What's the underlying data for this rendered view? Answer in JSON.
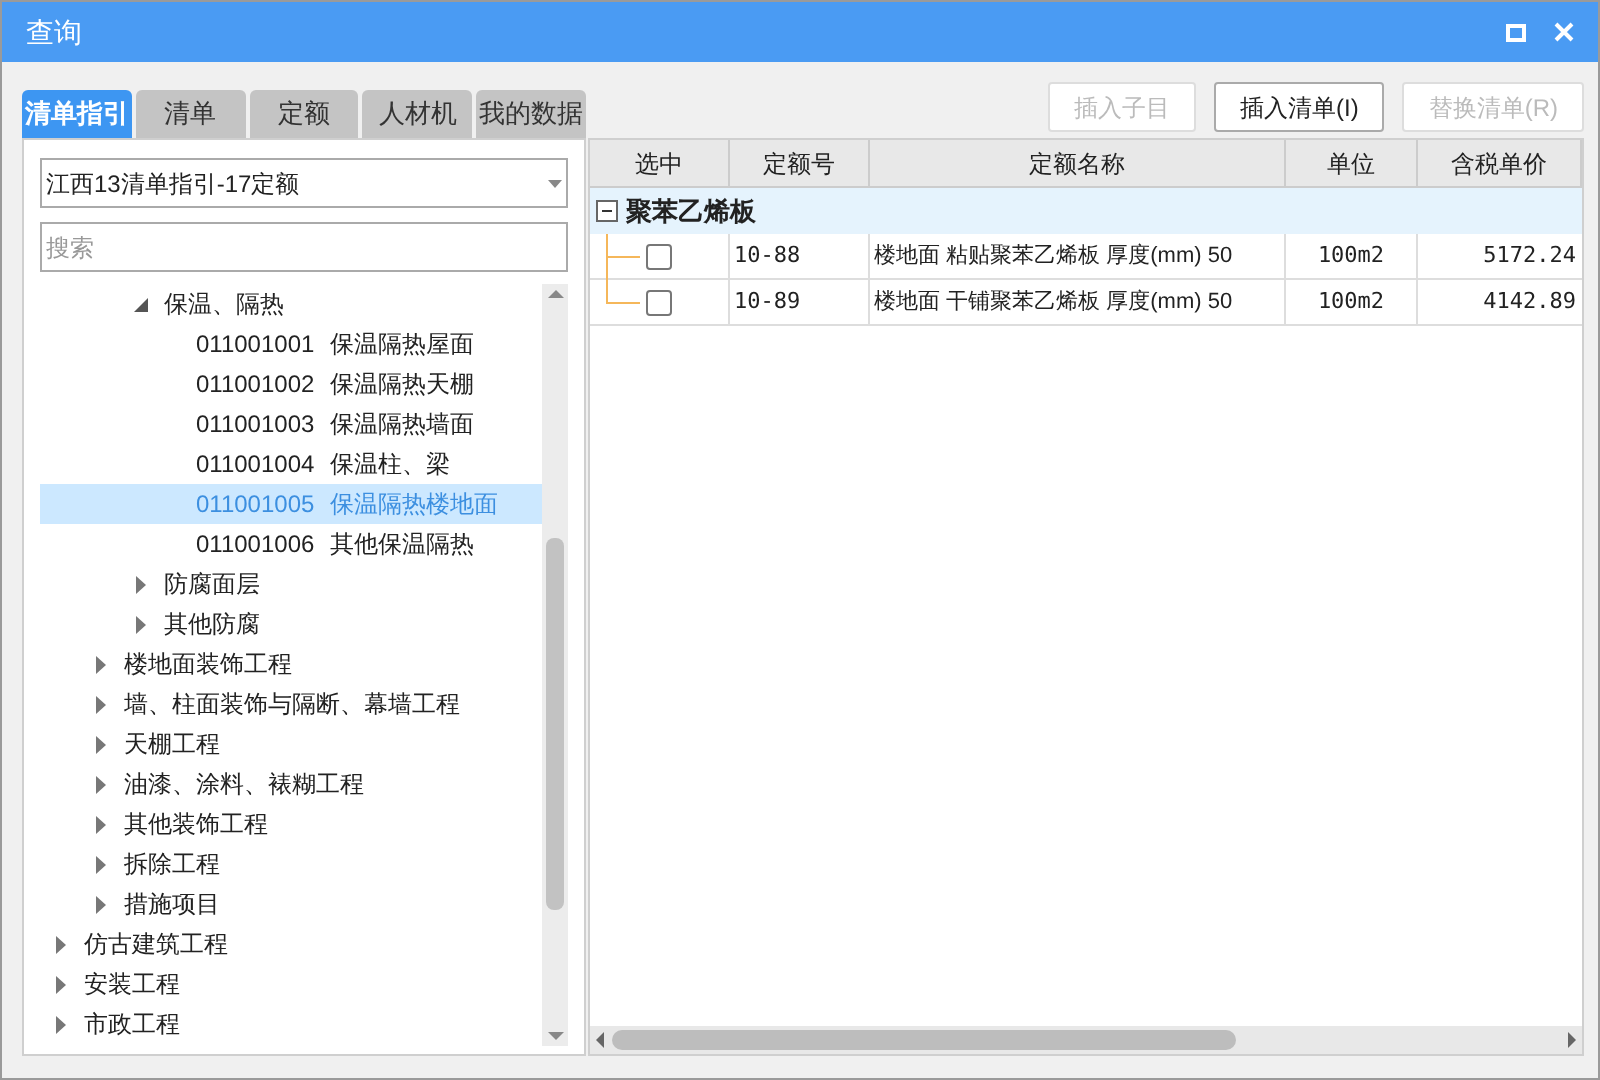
{
  "window": {
    "title": "查询"
  },
  "tabs": [
    {
      "label": "清单指引",
      "selected": true
    },
    {
      "label": "清单",
      "selected": false
    },
    {
      "label": "定额",
      "selected": false
    },
    {
      "label": "人材机",
      "selected": false
    },
    {
      "label": "我的数据",
      "selected": false
    }
  ],
  "buttons": [
    {
      "label": "插入子目",
      "disabled": true
    },
    {
      "label": "插入清单(I)",
      "disabled": false
    },
    {
      "label": "替换清单(R)",
      "disabled": true
    }
  ],
  "library_select": {
    "value": "江西13清单指引-17定额"
  },
  "search": {
    "placeholder": "搜索"
  },
  "tree": [
    {
      "children": [
        {
          "children": [
            {
              "label": "保温、隔热",
              "expanded": true,
              "children": [
                {
                  "code": "011001001",
                  "label": "保温隔热屋面",
                  "selected": false
                },
                {
                  "code": "011001002",
                  "label": "保温隔热天棚",
                  "selected": false
                },
                {
                  "code": "011001003",
                  "label": "保温隔热墙面",
                  "selected": false
                },
                {
                  "code": "011001004",
                  "label": "保温柱、梁",
                  "selected": false
                },
                {
                  "code": "011001005",
                  "label": "保温隔热楼地面",
                  "selected": true
                },
                {
                  "code": "011001006",
                  "label": "其他保温隔热",
                  "selected": false
                }
              ]
            },
            {
              "label": "防腐面层",
              "expanded": false
            },
            {
              "label": "其他防腐",
              "expanded": false
            }
          ]
        },
        {
          "label": "楼地面装饰工程",
          "expanded": false
        },
        {
          "label": "墙、柱面装饰与隔断、幕墙工程",
          "expanded": false
        },
        {
          "label": "天棚工程",
          "expanded": false
        },
        {
          "label": "油漆、涂料、裱糊工程",
          "expanded": false
        },
        {
          "label": "其他装饰工程",
          "expanded": false
        },
        {
          "label": "拆除工程",
          "expanded": false
        },
        {
          "label": "措施项目",
          "expanded": false
        }
      ]
    },
    {
      "label": "仿古建筑工程",
      "expanded": false
    },
    {
      "label": "安装工程",
      "expanded": false
    },
    {
      "label": "市政工程",
      "expanded": false
    }
  ],
  "table": {
    "columns": [
      "选中",
      "定额号",
      "定额名称",
      "单位",
      "含税单价"
    ],
    "group": {
      "label": "聚苯乙烯板",
      "expanded": true
    },
    "rows": [
      {
        "checked": false,
        "code": "10-88",
        "name": "楼地面 粘贴聚苯乙烯板 厚度(mm) 50",
        "unit": "100m2",
        "price": "5172.24"
      },
      {
        "checked": false,
        "code": "10-89",
        "name": "楼地面 干铺聚苯乙烯板 厚度(mm) 50",
        "unit": "100m2",
        "price": "4142.89"
      }
    ]
  }
}
